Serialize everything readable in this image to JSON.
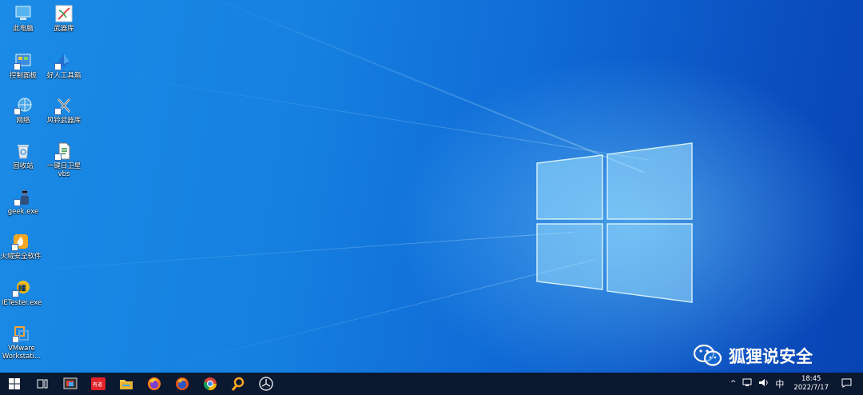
{
  "desktop": {
    "icons": [
      {
        "label": "此电脑",
        "icon": "computer-icon"
      },
      {
        "label": "控制面板",
        "icon": "control-panel-icon"
      },
      {
        "label": "网络",
        "icon": "network-icon"
      },
      {
        "label": "回收站",
        "icon": "recycle-bin-icon"
      },
      {
        "label": "geek.exe",
        "icon": "geek-app-icon"
      },
      {
        "label": "火绒安全软件",
        "icon": "huorong-security-icon"
      },
      {
        "label": "IETester.exe",
        "icon": "ietester-icon"
      },
      {
        "label": "VMware Workstati...",
        "icon": "vmware-icon"
      },
      {
        "label": "武器库",
        "icon": "arsenal-icon"
      },
      {
        "label": "好人工具箱",
        "icon": "toolbox-icon"
      },
      {
        "label": "风铃武器库",
        "icon": "fengling-arsenal-icon"
      },
      {
        "label": "一键日卫星 vbs",
        "icon": "vbs-script-icon"
      }
    ]
  },
  "watermark": {
    "text": "狐狸说安全",
    "icon": "wechat-icon"
  },
  "taskbar": {
    "apps": [
      "start-icon",
      "task-view-icon",
      "screenshot-tool-icon",
      "netease-youdao-icon",
      "file-explorer-icon",
      "firefox-icon",
      "firefox-alt-icon",
      "chrome-icon",
      "search-tool-icon",
      "unity-icon"
    ],
    "tray": {
      "chevron": "^",
      "input_method": "中",
      "time": "18:45",
      "date": "2022/7/17"
    }
  },
  "colors": {
    "accent": "#1580e0",
    "taskbar": "#0a1830"
  }
}
